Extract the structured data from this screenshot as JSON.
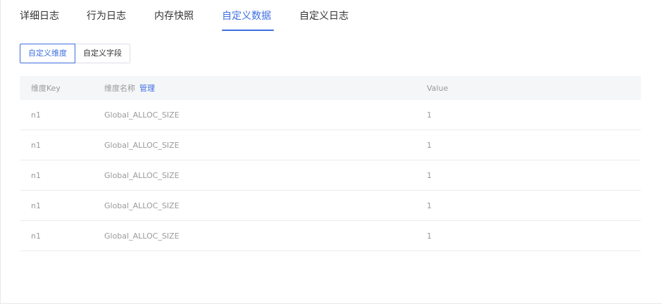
{
  "tabs": [
    {
      "label": "详细日志",
      "active": false
    },
    {
      "label": "行为日志",
      "active": false
    },
    {
      "label": "内存快照",
      "active": false
    },
    {
      "label": "自定义数据",
      "active": true
    },
    {
      "label": "自定义日志",
      "active": false
    }
  ],
  "subtabs": [
    {
      "label": "自定义维度",
      "active": true
    },
    {
      "label": "自定义字段",
      "active": false
    }
  ],
  "table": {
    "headers": {
      "key": "维度Key",
      "name": "维度名称",
      "manage": "管理",
      "value": "Value"
    },
    "rows": [
      {
        "key": "n1",
        "name": "Global_ALLOC_SIZE",
        "value": "1"
      },
      {
        "key": "n1",
        "name": "Global_ALLOC_SIZE",
        "value": "1"
      },
      {
        "key": "n1",
        "name": "Global_ALLOC_SIZE",
        "value": "1"
      },
      {
        "key": "n1",
        "name": "Global_ALLOC_SIZE",
        "value": "1"
      },
      {
        "key": "n1",
        "name": "Global_ALLOC_SIZE",
        "value": "1"
      }
    ]
  },
  "colors": {
    "accent": "#3e6fe0",
    "header_bg": "#f5f6f8",
    "muted_text": "#9a9a9a"
  }
}
